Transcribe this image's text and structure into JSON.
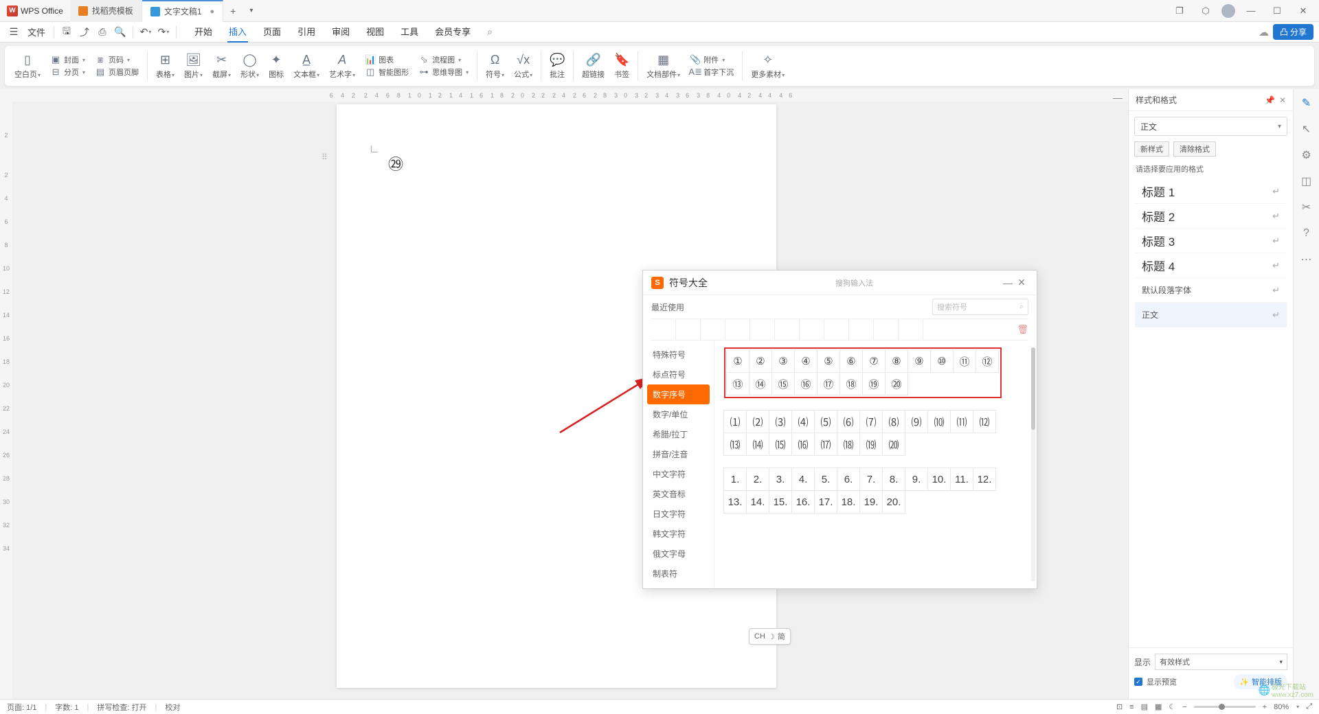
{
  "titlebar": {
    "app_name": "WPS Office",
    "tabs": [
      {
        "label": "找稻壳模板"
      },
      {
        "label": "文字文稿1"
      }
    ]
  },
  "menubar": {
    "file": "文件",
    "tabs": [
      "开始",
      "插入",
      "页面",
      "引用",
      "审阅",
      "视图",
      "工具",
      "会员专享"
    ],
    "active_tab": "插入",
    "share": "分享"
  },
  "ribbon": {
    "blank_page": "空白页",
    "cover": "封面",
    "page_num": "页码",
    "page_break": "分页",
    "header_footer": "页眉页脚",
    "table": "表格",
    "picture": "图片",
    "screenshot": "截屏",
    "shape": "形状",
    "icon": "图标",
    "textbox": "文本框",
    "wordart": "艺术字",
    "chart": "图表",
    "smart_graphic": "智能图形",
    "flowchart": "流程图",
    "mindmap": "思维导图",
    "symbol": "符号",
    "formula": "公式",
    "comment": "批注",
    "hyperlink": "超链接",
    "bookmark": "书签",
    "doc_parts": "文档部件",
    "attachment": "附件",
    "dropcap": "首字下沉",
    "more": "更多素材"
  },
  "ruler_h": [
    "6",
    "4",
    "2",
    "",
    "2",
    "4",
    "6",
    "8",
    "10",
    "12",
    "14",
    "16",
    "18",
    "20",
    "22",
    "24",
    "26",
    "28",
    "30",
    "32",
    "34",
    "36",
    "38",
    "40",
    "42",
    "44",
    "46"
  ],
  "ruler_v": [
    "",
    "2",
    "",
    "2",
    "4",
    "6",
    "8",
    "10",
    "12",
    "14",
    "16",
    "18",
    "20",
    "22",
    "24",
    "26",
    "28",
    "30",
    "32",
    "34"
  ],
  "document": {
    "inserted_symbol": "㉙"
  },
  "ime_indicator": {
    "lang": "CH",
    "icon": "☽",
    "mode": "简"
  },
  "dialog": {
    "title": "符号大全",
    "ime_name": "搜狗输入法",
    "recent_label": "最近使用",
    "search_placeholder": "搜索符号",
    "categories": [
      "特殊符号",
      "标点符号",
      "数字序号",
      "数字/单位",
      "希腊/拉丁",
      "拼音/注音",
      "中文字符",
      "英文音标",
      "日文字符",
      "韩文字符",
      "俄文字母",
      "制表符"
    ],
    "active_category": "数字序号",
    "groups": [
      {
        "highlighted": true,
        "rows": [
          [
            "①",
            "②",
            "③",
            "④",
            "⑤",
            "⑥",
            "⑦",
            "⑧",
            "⑨",
            "⑩",
            "⑪",
            "⑫"
          ],
          [
            "⑬",
            "⑭",
            "⑮",
            "⑯",
            "⑰",
            "⑱",
            "⑲",
            "⑳"
          ]
        ]
      },
      {
        "highlighted": false,
        "rows": [
          [
            "⑴",
            "⑵",
            "⑶",
            "⑷",
            "⑸",
            "⑹",
            "⑺",
            "⑻",
            "⑼",
            "⑽",
            "⑾",
            "⑿"
          ],
          [
            "⒀",
            "⒁",
            "⒂",
            "⒃",
            "⒄",
            "⒅",
            "⒆",
            "⒇"
          ]
        ]
      },
      {
        "highlighted": false,
        "rows": [
          [
            "1.",
            "2.",
            "3.",
            "4.",
            "5.",
            "6.",
            "7.",
            "8.",
            "9.",
            "10.",
            "11.",
            "12."
          ],
          [
            "13.",
            "14.",
            "15.",
            "16.",
            "17.",
            "18.",
            "19.",
            "20."
          ]
        ]
      }
    ]
  },
  "side_panel": {
    "title": "样式和格式",
    "current_style": "正文",
    "new_style_btn": "新样式",
    "clear_format_btn": "清除格式",
    "hint": "请选择要应用的格式",
    "styles": [
      {
        "name": "标题 1",
        "selected": false,
        "size": "big"
      },
      {
        "name": "标题 2",
        "selected": false,
        "size": "big"
      },
      {
        "name": "标题 3",
        "selected": false,
        "size": "big"
      },
      {
        "name": "标题 4",
        "selected": false,
        "size": "big"
      },
      {
        "name": "默认段落字体",
        "selected": false,
        "size": "small"
      },
      {
        "name": "正文",
        "selected": true,
        "size": "small"
      }
    ],
    "display_label": "显示",
    "display_value": "有效样式",
    "smart_typeset": "智能排版",
    "show_preview": "显示预览"
  },
  "statusbar": {
    "page": "页面: 1/1",
    "words": "字数: 1",
    "spell": "拼写检查: 打开",
    "proof": "校对",
    "zoom": "80%"
  },
  "watermark": {
    "site": "极光下载站",
    "url": "www.xz7.com"
  }
}
